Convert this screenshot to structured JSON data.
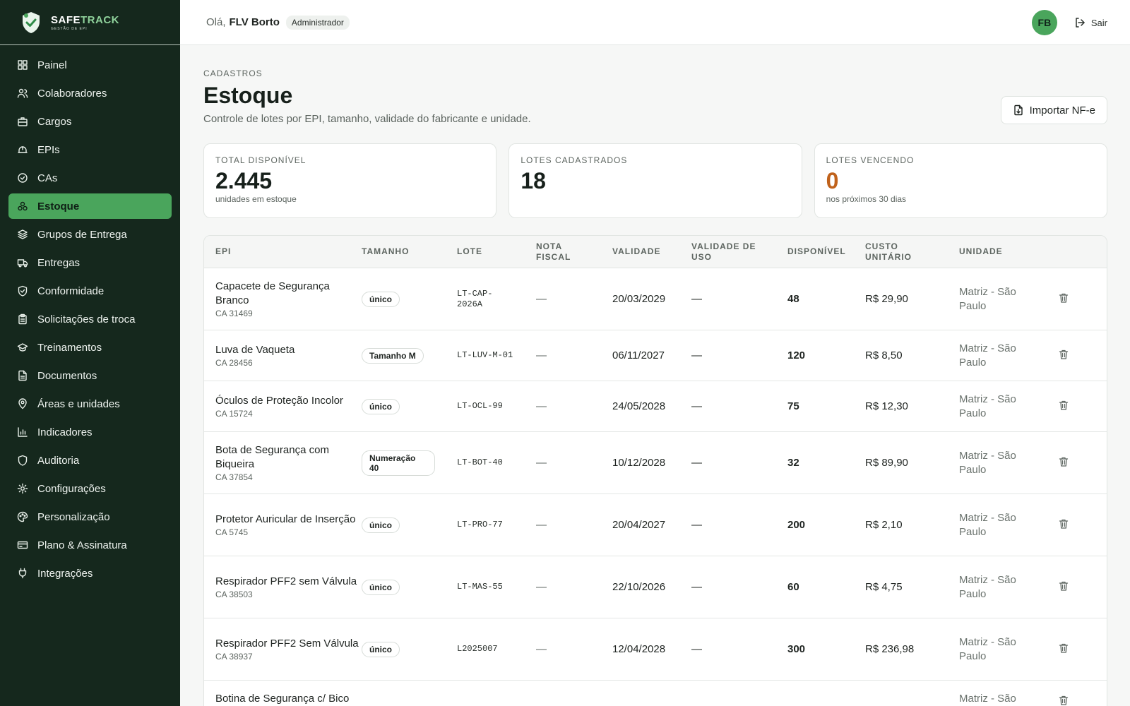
{
  "brand": {
    "name_main": "SAFE",
    "name_accent": "TRACK",
    "tagline": "GESTÃO DE EPI"
  },
  "sidebar": {
    "items": [
      {
        "label": "Painel",
        "icon": "dashboard-icon"
      },
      {
        "label": "Colaboradores",
        "icon": "users-icon"
      },
      {
        "label": "Cargos",
        "icon": "briefcase-icon"
      },
      {
        "label": "EPIs",
        "icon": "helmet-icon"
      },
      {
        "label": "CAs",
        "icon": "check-circle-icon"
      },
      {
        "label": "Estoque",
        "icon": "boxes-icon",
        "active": true
      },
      {
        "label": "Grupos de Entrega",
        "icon": "layers-icon"
      },
      {
        "label": "Entregas",
        "icon": "truck-icon"
      },
      {
        "label": "Conformidade",
        "icon": "shield-check-icon"
      },
      {
        "label": "Solicitações de troca",
        "icon": "clipboard-icon"
      },
      {
        "label": "Treinamentos",
        "icon": "graduation-cap-icon"
      },
      {
        "label": "Documentos",
        "icon": "file-icon"
      },
      {
        "label": "Áreas e unidades",
        "icon": "map-pin-icon"
      },
      {
        "label": "Indicadores",
        "icon": "bar-chart-icon"
      },
      {
        "label": "Auditoria",
        "icon": "shield-icon"
      },
      {
        "label": "Configurações",
        "icon": "gear-icon"
      },
      {
        "label": "Personalização",
        "icon": "palette-icon"
      },
      {
        "label": "Plano & Assinatura",
        "icon": "credit-card-icon"
      },
      {
        "label": "Integrações",
        "icon": "plug-icon"
      }
    ]
  },
  "topbar": {
    "greeting": "Olá,",
    "user_name": "FLV Borto",
    "role": "Administrador",
    "avatar_initials": "FB",
    "logout_label": "Sair"
  },
  "page": {
    "breadcrumb": "CADASTROS",
    "title": "Estoque",
    "subtitle": "Controle de lotes por EPI, tamanho, validade do fabricante e unidade.",
    "import_button": "Importar NF-e"
  },
  "stats": [
    {
      "label": "TOTAL DISPONÍVEL",
      "value": "2.445",
      "note": "unidades em estoque"
    },
    {
      "label": "LOTES CADASTRADOS",
      "value": "18",
      "note": ""
    },
    {
      "label": "LOTES VENCENDO",
      "value": "0",
      "note": "nos próximos 30 dias"
    }
  ],
  "table": {
    "headers": {
      "epi": "EPI",
      "tamanho": "TAMANHO",
      "lote": "LOTE",
      "nf": "NOTA FISCAL",
      "validade": "VALIDADE",
      "uso": "VALIDADE DE USO",
      "disp": "DISPONÍVEL",
      "custo": "CUSTO UNITÁRIO",
      "unidade": "UNIDADE"
    },
    "rows": [
      {
        "name": "Capacete de Segurança Branco",
        "ca": "CA 31469",
        "size": "único",
        "lote": "LT-CAP-2026A",
        "nf": "—",
        "validade": "20/03/2029",
        "uso": "—",
        "disp": "48",
        "custo": "R$ 29,90",
        "unidade": "Matriz - São Paulo"
      },
      {
        "name": "Luva de Vaqueta",
        "ca": "CA 28456",
        "size": "Tamanho M",
        "lote": "LT-LUV-M-01",
        "nf": "—",
        "validade": "06/11/2027",
        "uso": "—",
        "disp": "120",
        "custo": "R$ 8,50",
        "unidade": "Matriz - São Paulo"
      },
      {
        "name": "Óculos de Proteção Incolor",
        "ca": "CA 15724",
        "size": "único",
        "lote": "LT-OCL-99",
        "nf": "—",
        "validade": "24/05/2028",
        "uso": "—",
        "disp": "75",
        "custo": "R$ 12,30",
        "unidade": "Matriz - São Paulo"
      },
      {
        "name": "Bota de Segurança com Biqueira",
        "ca": "CA 37854",
        "size": "Numeração 40",
        "lote": "LT-BOT-40",
        "nf": "—",
        "validade": "10/12/2028",
        "uso": "—",
        "disp": "32",
        "custo": "R$ 89,90",
        "unidade": "Matriz - São Paulo"
      },
      {
        "name": "Protetor Auricular de Inserção",
        "ca": "CA 5745",
        "size": "único",
        "lote": "LT-PRO-77",
        "nf": "—",
        "validade": "20/04/2027",
        "uso": "—",
        "disp": "200",
        "custo": "R$ 2,10",
        "unidade": "Matriz - São Paulo"
      },
      {
        "name": "Respirador PFF2 sem Válvula",
        "ca": "CA 38503",
        "size": "único",
        "lote": "LT-MAS-55",
        "nf": "—",
        "validade": "22/10/2026",
        "uso": "—",
        "disp": "60",
        "custo": "R$ 4,75",
        "unidade": "Matriz - São Paulo"
      },
      {
        "name": "Respirador PFF2 Sem Válvula",
        "ca": "CA 38937",
        "size": "único",
        "lote": "L2025007",
        "nf": "—",
        "validade": "12/04/2028",
        "uso": "—",
        "disp": "300",
        "custo": "R$ 236,98",
        "unidade": "Matriz - São Paulo"
      },
      {
        "name": "Botina de Segurança c/ Bico",
        "ca": "",
        "size": "",
        "lote": "",
        "nf": "",
        "validade": "",
        "uso": "",
        "disp": "",
        "custo": "",
        "unidade": "Matriz - São"
      }
    ]
  },
  "colors": {
    "sidebar_bg": "#15281d",
    "accent": "#4aa55c",
    "warning": "#c0621b"
  }
}
